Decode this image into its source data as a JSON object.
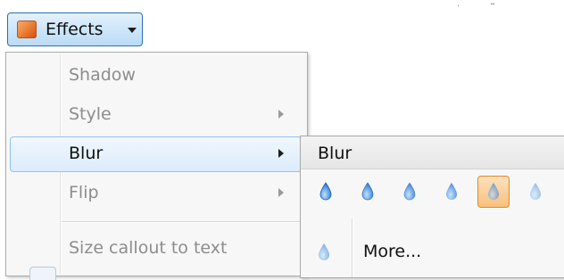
{
  "effects_button": {
    "label": "Effects",
    "icon": "effects-square-icon"
  },
  "menu": {
    "items": [
      {
        "label": "Shadow",
        "enabled": false,
        "submenu": false
      },
      {
        "label": "Style",
        "enabled": false,
        "submenu": true
      },
      {
        "label": "Blur",
        "enabled": true,
        "submenu": true,
        "highlighted": true
      },
      {
        "label": "Flip",
        "enabled": false,
        "submenu": true
      },
      {
        "label": "Size callout to text",
        "enabled": false,
        "submenu": false
      }
    ]
  },
  "submenu": {
    "title": "Blur",
    "swatches": [
      {
        "icon": "blur-drop-icon",
        "level": 1
      },
      {
        "icon": "blur-drop-icon",
        "level": 2
      },
      {
        "icon": "blur-drop-icon",
        "level": 3
      },
      {
        "icon": "blur-drop-icon",
        "level": 4
      },
      {
        "icon": "blur-drop-icon",
        "level": 5,
        "selected": true
      },
      {
        "icon": "blur-drop-icon",
        "level": 6
      }
    ],
    "more_label": "More..."
  },
  "colors": {
    "accent_border": "#2a6fb0",
    "highlight_border": "#90c3ee",
    "selected_border": "#e08a2c",
    "drop_blue": "#2e7ad1"
  }
}
